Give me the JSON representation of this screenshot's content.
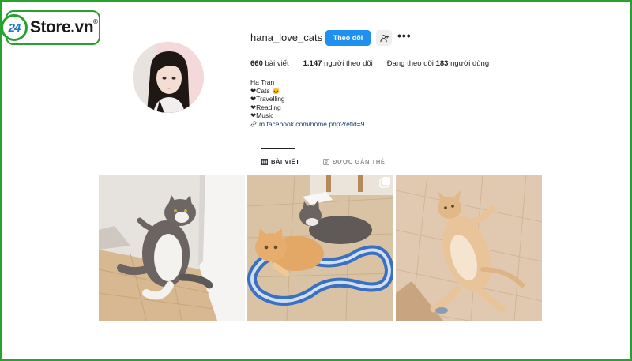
{
  "watermark": {
    "badge": "24",
    "brand": "Store.vn",
    "mark": "®"
  },
  "profile": {
    "username": "hana_love_cats",
    "follow_label": "Theo dõi",
    "stats": {
      "posts_count": "660",
      "posts_label": "bài viết",
      "followers_count": "1.147",
      "followers_label": "người theo dõi",
      "following_prefix": "Đang theo dõi",
      "following_count": "183",
      "following_suffix": "người dùng"
    },
    "bio": {
      "name": "Ha Tran",
      "lines": [
        "❤Cats 🐱",
        "❤Travelling",
        "❤Reading",
        "❤Music"
      ],
      "link": "m.facebook.com/home.php?refid=9"
    }
  },
  "tabs": [
    {
      "label": "BÀI VIẾT",
      "icon": "grid-icon",
      "active": true
    },
    {
      "label": "ĐƯỢC GẮN THẺ",
      "icon": "tag-person-icon",
      "active": false
    }
  ],
  "posts": [
    {
      "subject": "grey-white-cat-leaning-on-wall"
    },
    {
      "subject": "two-cats-with-toy-track",
      "badge_icon": "multi-photo-icon"
    },
    {
      "subject": "ginger-cat-lying-on-floor"
    }
  ],
  "colors": {
    "accent": "#1f8ff0",
    "frame": "#27a22e",
    "text": "#222222",
    "muted": "#8e8e8e"
  }
}
